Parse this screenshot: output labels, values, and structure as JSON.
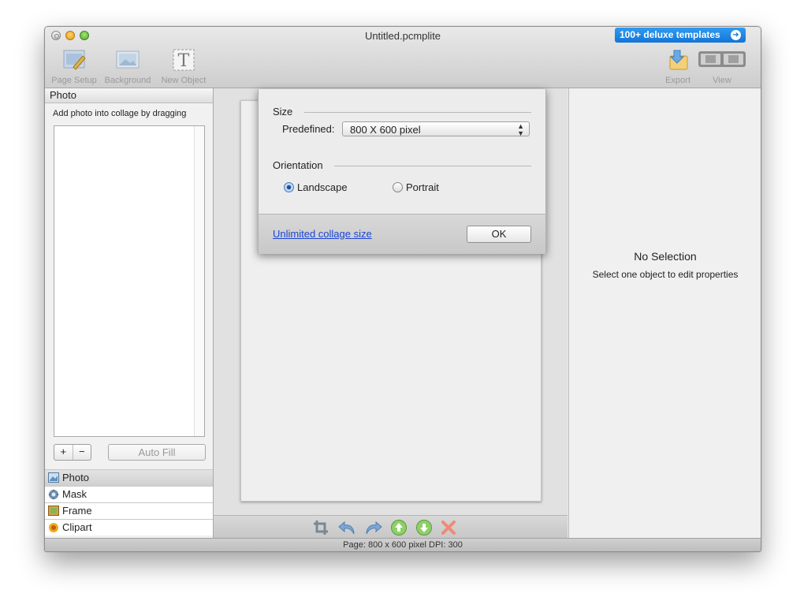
{
  "window": {
    "title": "Untitled.pcmplite"
  },
  "promo": {
    "label": "100+ deluxe templates"
  },
  "toolbar": {
    "page_setup": "Page Setup",
    "background": "Background",
    "new_object": "New Object",
    "export": "Export",
    "view": "View"
  },
  "left_panel": {
    "header": "Photo",
    "hint": "Add photo into collage by dragging",
    "add": "+",
    "remove": "−",
    "auto_fill": "Auto Fill",
    "tabs": [
      {
        "label": "Photo"
      },
      {
        "label": "Mask"
      },
      {
        "label": "Frame"
      },
      {
        "label": "Clipart"
      }
    ]
  },
  "dialog": {
    "size_section": "Size",
    "predefined_label": "Predefined:",
    "predefined_value": "800 X 600 pixel",
    "orientation_section": "Orientation",
    "landscape": "Landscape",
    "portrait": "Portrait",
    "selected_orientation": "Landscape",
    "link": "Unlimited collage size",
    "ok": "OK"
  },
  "properties": {
    "title": "No Selection",
    "subtitle": "Select one object to edit properties"
  },
  "status": {
    "text": "Page: 800 x 600 pixel DPI: 300"
  },
  "colors": {
    "accent": "#1474d6",
    "link": "#1a44d6"
  }
}
